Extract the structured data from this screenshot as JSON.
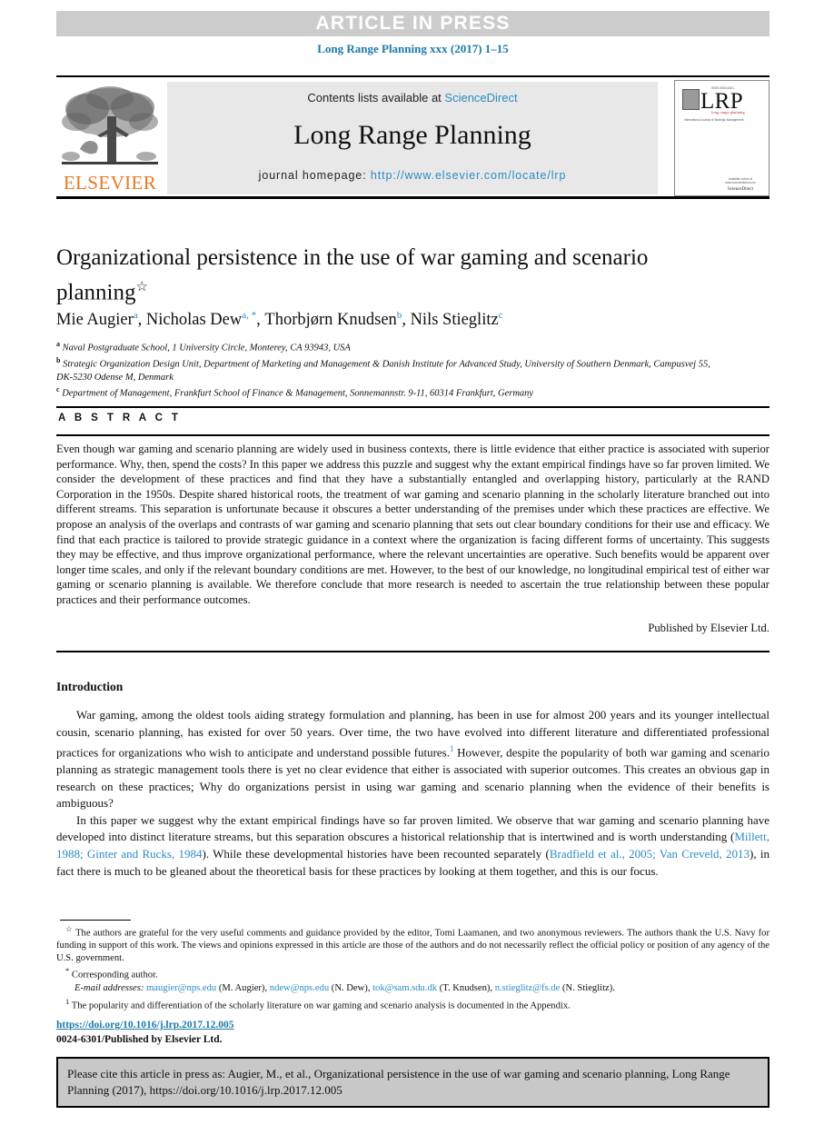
{
  "banner": {
    "article_in_press": "ARTICLE IN PRESS",
    "running_head": "Long Range Planning xxx (2017) 1–15"
  },
  "masthead": {
    "contents_prefix": "Contents lists available at ",
    "sciencedirect": "ScienceDirect",
    "journal_title": "Long Range Planning",
    "homepage_prefix": "journal homepage: ",
    "homepage_url": "http://www.elsevier.com/locate/lrp",
    "publisher_wordmark": "ELSEVIER",
    "publisher_color": "#e87722",
    "link_color": "#2b8bc4",
    "cover": {
      "top_label": "ISSN 0024-6301",
      "acronym": "LRP",
      "subtitle": "long range planning",
      "subtitle_color": "#c0392b",
      "description": "International Journal of Strategic Management",
      "bottom_label": "Available online at www.sciencedirect.com",
      "bottom_brand": "ScienceDirect"
    }
  },
  "article": {
    "title": "Organizational persistence in the use of war gaming and scenario planning",
    "title_footnote_mark": "☆",
    "authors": [
      {
        "name": "Mie Augier",
        "marks": "a"
      },
      {
        "name": "Nicholas Dew",
        "marks": "a, *"
      },
      {
        "name": "Thorbjørn Knudsen",
        "marks": "b"
      },
      {
        "name": "Nils Stieglitz",
        "marks": "c"
      }
    ],
    "affiliations": [
      {
        "mark": "a",
        "text": "Naval Postgraduate School, 1 University Circle, Monterey, CA 93943, USA"
      },
      {
        "mark": "b",
        "text": "Strategic Organization Design Unit, Department of Marketing and Management & Danish Institute for Advanced Study, University of Southern Denmark, Campusvej 55, DK-5230 Odense M, Denmark"
      },
      {
        "mark": "c",
        "text": "Department of Management, Frankfurt School of Finance & Management, Sonnemannstr. 9-11, 60314 Frankfurt, Germany"
      }
    ]
  },
  "abstract": {
    "heading": "A B S T R A C T",
    "text": "Even though war gaming and scenario planning are widely used in business contexts, there is little evidence that either practice is associated with superior performance. Why, then, spend the costs? In this paper we address this puzzle and suggest why the extant empirical findings have so far proven limited. We consider the development of these practices and find that they have a substantially entangled and overlapping history, particularly at the RAND Corporation in the 1950s. Despite shared historical roots, the treatment of war gaming and scenario planning in the scholarly literature branched out into different streams. This separation is unfortunate because it obscures a better understanding of the premises under which these practices are effective. We propose an analysis of the overlaps and contrasts of war gaming and scenario planning that sets out clear boundary conditions for their use and efficacy. We find that each practice is tailored to provide strategic guidance in a context where the organization is facing different forms of uncertainty. This suggests they may be effective, and thus improve organizational performance, where the relevant uncertainties are operative. Such benefits would be apparent over longer time scales, and only if the relevant boundary conditions are met. However, to the best of our knowledge, no longitudinal empirical test of either war gaming or scenario planning is available. We therefore conclude that more research is needed to ascertain the true relationship between these popular practices and their performance outcomes.",
    "publisher_note": "Published by Elsevier Ltd."
  },
  "introduction": {
    "heading": "Introduction",
    "para1_a": "War gaming, among the oldest tools aiding strategy formulation and planning, has been in use for almost 200 years and its younger intellectual cousin, scenario planning, has existed for over 50 years. Over time, the two have evolved into different literature and differentiated professional practices for organizations who wish to anticipate and understand possible futures.",
    "para1_footnote": "1",
    "para1_b": " However, despite the popularity of both war gaming and scenario planning as strategic management tools there is yet no clear evidence that either is associated with superior outcomes. This creates an obvious gap in research on these practices; Why do organizations persist in using war gaming and scenario planning when the evidence of their benefits is ambiguous?",
    "para2_a": "In this paper we suggest why the extant empirical findings have so far proven limited. We observe that war gaming and scenario planning have developed into distinct literature streams, but this separation obscures a historical relationship that is intertwined and is worth understanding (",
    "para2_cite1": "Millett, 1988; Ginter and Rucks, 1984",
    "para2_b": "). While these developmental histories have been recounted separately (",
    "para2_cite2": "Bradfield et al., 2005; Van Creveld, 2013",
    "para2_c": "), in fact there is much to be gleaned about the theoretical basis for these practices by looking at them together, and this is our focus."
  },
  "footnotes": {
    "star_mark": "☆",
    "star_text": "The authors are grateful for the very useful comments and guidance provided by the editor, Tomi Laamanen, and two anonymous reviewers. The authors thank the U.S. Navy for funding in support of this work. The views and opinions expressed in this article are those of the authors and do not necessarily reflect the official policy or position of any agency of the U.S. government.",
    "corresponding_mark": "*",
    "corresponding_text": "Corresponding author.",
    "email_label": "E-mail addresses:",
    "emails": [
      {
        "address": "maugier@nps.edu",
        "owner": "(M. Augier)"
      },
      {
        "address": "ndew@nps.edu",
        "owner": "(N. Dew)"
      },
      {
        "address": "tok@sam.sdu.dk",
        "owner": "(T. Knudsen)"
      },
      {
        "address": "n.stieglitz@fs.de",
        "owner": "(N. Stieglitz)"
      }
    ],
    "note1_mark": "1",
    "note1_text": "The popularity and differentiation of the scholarly literature on war gaming and scenario analysis is documented in the Appendix."
  },
  "publication": {
    "doi": "https://doi.org/10.1016/j.lrp.2017.12.005",
    "issn_line": "0024-6301/Published by Elsevier Ltd."
  },
  "cite_box": {
    "text": "Please cite this article in press as: Augier, M., et al., Organizational persistence in the use of war gaming and scenario planning, Long Range Planning (2017), https://doi.org/10.1016/j.lrp.2017.12.005"
  }
}
